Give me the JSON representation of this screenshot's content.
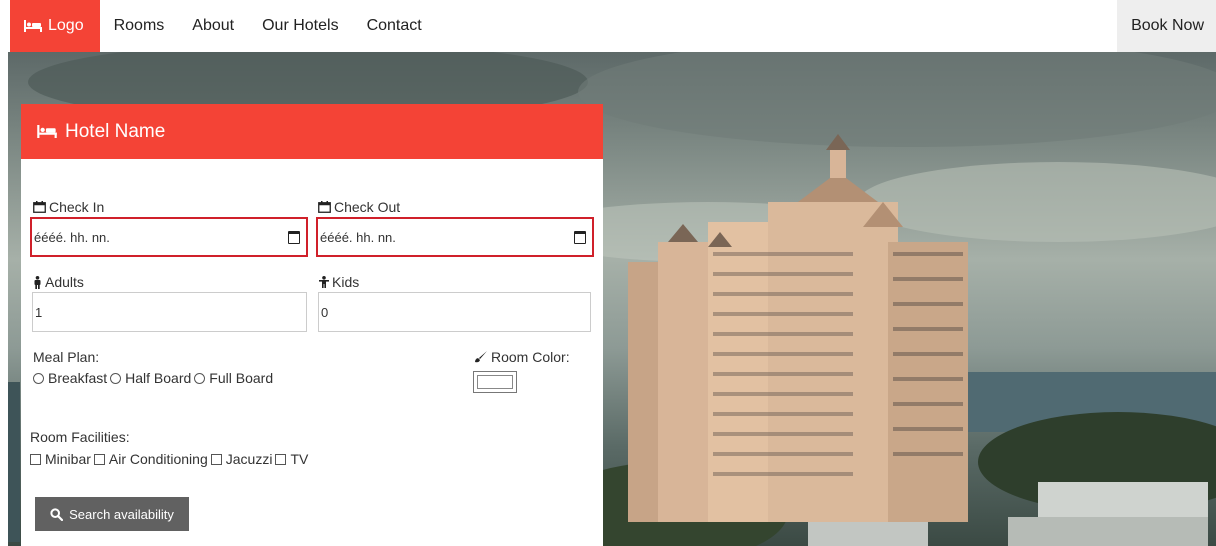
{
  "nav": {
    "logo_label": "Logo",
    "items": [
      {
        "label": "Rooms"
      },
      {
        "label": "About"
      },
      {
        "label": "Our Hotels"
      },
      {
        "label": "Contact"
      }
    ],
    "book_now_label": "Book Now"
  },
  "colors": {
    "accent": "#f44336",
    "date_border": "#d0202a",
    "search_button": "#616161"
  },
  "booking": {
    "hotel_name": "Hotel Name",
    "check_in": {
      "label": "Check In",
      "placeholder": "éééé. hh. nn."
    },
    "check_out": {
      "label": "Check Out",
      "placeholder": "éééé. hh. nn."
    },
    "adults": {
      "label": "Adults",
      "value": "1"
    },
    "kids": {
      "label": "Kids",
      "value": "0"
    },
    "meal_plan": {
      "label": "Meal Plan:",
      "options": [
        "Breakfast",
        "Half Board",
        "Full Board"
      ]
    },
    "room_color": {
      "label": "Room Color:"
    },
    "room_facilities": {
      "label": "Room Facilities:",
      "options": [
        "Minibar",
        "Air Conditioning",
        "Jacuzzi",
        "TV"
      ]
    },
    "search_label": "Search availability"
  },
  "icons": {
    "logo": "bed-icon",
    "header": "bed-icon",
    "check_in": "calendar-icon",
    "check_out": "calendar-icon",
    "adults": "male-icon",
    "kids": "child-icon",
    "room_color": "paint-brush-icon",
    "search": "search-icon"
  }
}
